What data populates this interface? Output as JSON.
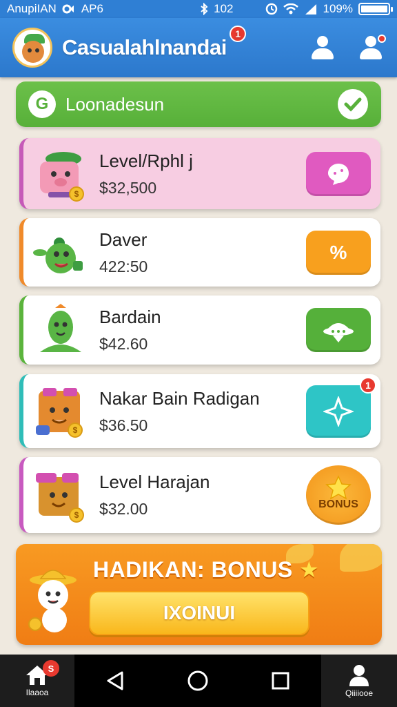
{
  "status_bar": {
    "carrier": "AnupiIAN",
    "network": "AP6",
    "time": "102",
    "battery": "109%",
    "battery_level": 1.0
  },
  "header": {
    "title": "Casualahlnandai",
    "title_badge": "1"
  },
  "banner": {
    "icon_letter": "G",
    "label": "Loonadesun"
  },
  "items": [
    {
      "name": "Level/Rphl j",
      "price": "$32,500",
      "action_color": "#e05ac0",
      "accent": "#c659b8"
    },
    {
      "name": "Daver",
      "price": "422:50",
      "action_glyph": "%",
      "action_color": "#f8a01e",
      "accent": "#f08a2a"
    },
    {
      "name": "Bardain",
      "price": "$42.60",
      "action_color": "#55b03a",
      "accent": "#5bb43c"
    },
    {
      "name": "Nakar Bain Radigan",
      "price": "$36.50",
      "action_color": "#2ec5c6",
      "accent": "#2fbdb8",
      "badge": "1"
    },
    {
      "name": "Level Harajan",
      "price": "$32.00",
      "action_color": "#f8a51f",
      "accent": "#c85ac0",
      "action_label": "BONUS"
    }
  ],
  "bonus": {
    "title": "HADIKAN: BONUS",
    "star": "★",
    "button": "IXOINUI"
  },
  "nav": {
    "home_label": "Ilaaoa",
    "home_badge": "S",
    "profile_label": "Qiiiiooe"
  }
}
